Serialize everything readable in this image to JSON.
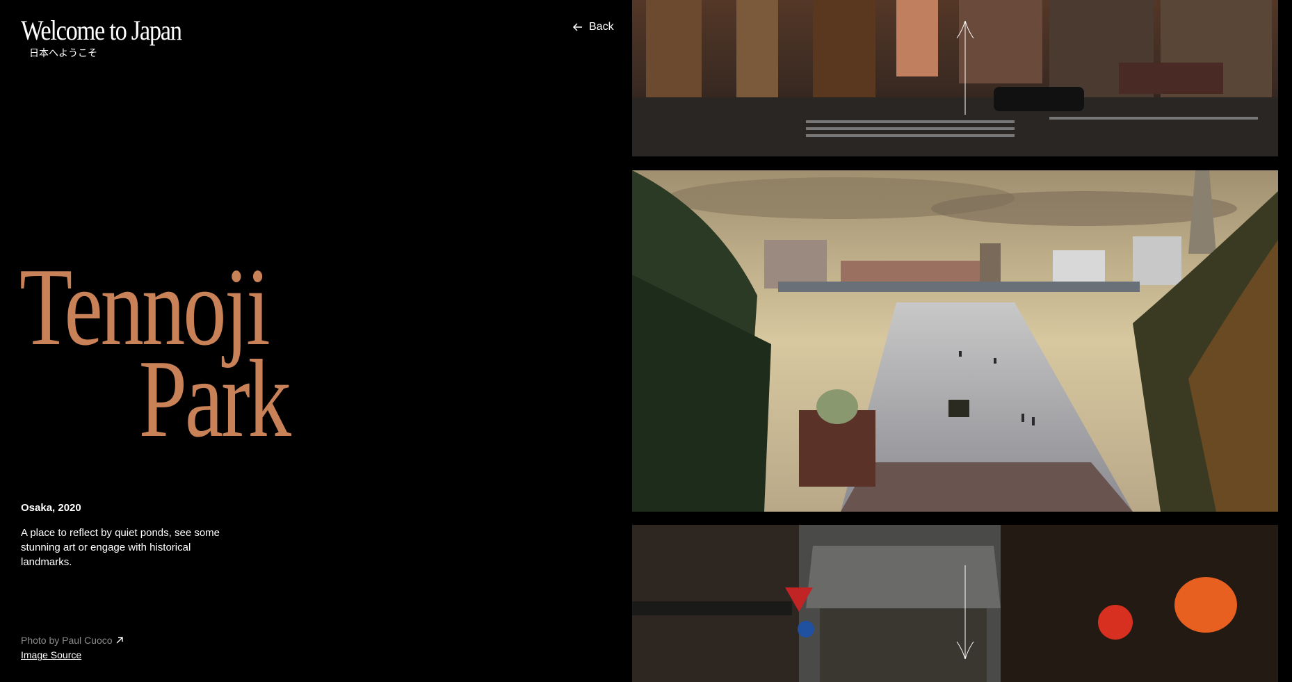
{
  "header": {
    "title": "Welcome to Japan",
    "subtitle": "日本へようこそ"
  },
  "nav": {
    "back_label": "Back"
  },
  "hero": {
    "line1": "Tennoji",
    "line2": "Park"
  },
  "details": {
    "location": "Osaka, 2020",
    "description": "A place to reflect by quiet ponds, see some stunning art or engage with historical landmarks."
  },
  "credit": {
    "photo_by": "Photo by Paul Cuoco",
    "source_label": "Image Source"
  },
  "colors": {
    "accent": "#c98157",
    "background": "#000000"
  },
  "icons": {
    "back": "arrow-left-icon",
    "external": "arrow-up-right-icon",
    "scroll_up": "arrow-up-icon",
    "scroll_down": "arrow-down-icon"
  }
}
